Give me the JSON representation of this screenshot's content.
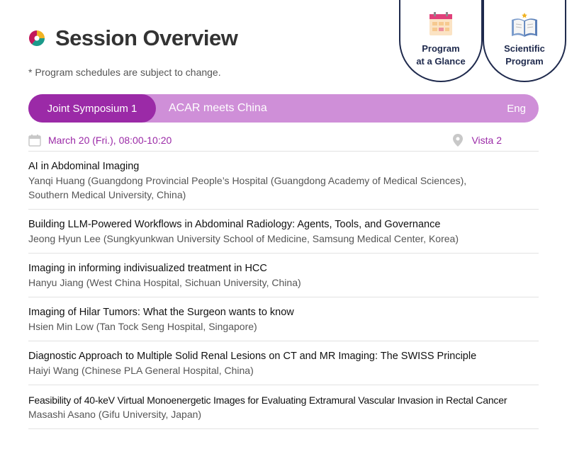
{
  "header": {
    "title": "Session Overview",
    "notice": "* Program schedules are subject to change."
  },
  "quick_links": [
    {
      "label": "Program\nat a Glance",
      "icon": "calendar-icon"
    },
    {
      "label": "Scientific\nProgram",
      "icon": "open-book-icon"
    }
  ],
  "session": {
    "type": "Joint Symposium 1",
    "name": "ACAR meets China",
    "language": "Eng",
    "date_time": "March 20 (Fri.), 08:00-10:20",
    "venue": "Vista 2"
  },
  "colors": {
    "accent_purple": "#9b2aa7",
    "bar_light": "#cf8fd8",
    "navy": "#1f2a4d"
  },
  "talks": [
    {
      "title": "AI in Abdominal Imaging",
      "speaker": "Yanqi Huang (Guangdong Provincial People’s Hospital (Guangdong Academy of Medical Sciences),\nSouthern Medical University, China)"
    },
    {
      "title": "Building LLM-Powered Workflows in Abdominal Radiology: Agents, Tools, and Governance",
      "speaker": "Jeong Hyun Lee (Sungkyunkwan University School of Medicine, Samsung Medical Center, Korea)"
    },
    {
      "title": "Imaging in informing indivisualized treatment in HCC",
      "speaker": "Hanyu Jiang (West China Hospital, Sichuan University, China)"
    },
    {
      "title": "Imaging of Hilar Tumors: What the Surgeon wants to know",
      "speaker": "Hsien Min Low (Tan Tock Seng Hospital, Singapore)"
    },
    {
      "title": "Diagnostic Approach to Multiple Solid Renal Lesions on CT and MR Imaging: The SWISS Principle",
      "speaker": "Haiyi Wang (Chinese PLA General Hospital, China)"
    },
    {
      "title": "Feasibility of 40-keV Virtual Monoenergetic Images for Evaluating Extramural Vascular Invasion in Rectal Cancer",
      "speaker": "Masashi Asano (Gifu University, Japan)"
    }
  ]
}
